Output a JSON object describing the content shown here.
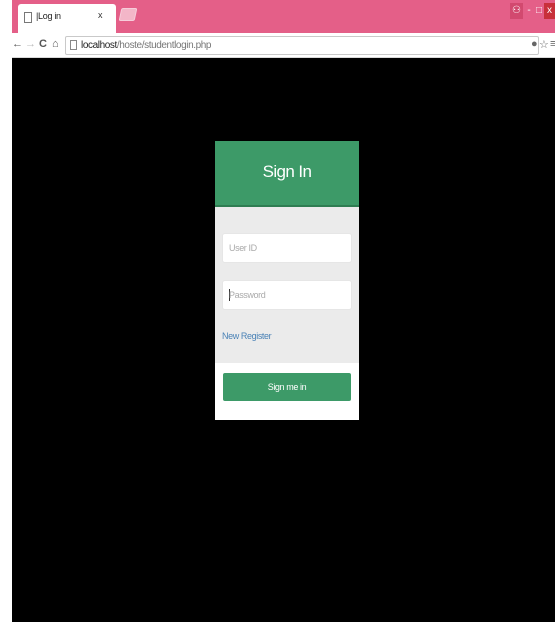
{
  "browser": {
    "tab_title": "|Log in",
    "tab_close": "x",
    "url_host": "localhost",
    "url_path": "/hoste/studentlogin.php",
    "window_controls": {
      "minimize": "-",
      "maximize": "□",
      "close": "x"
    }
  },
  "login": {
    "title": "Sign In",
    "user_placeholder": "User ID",
    "password_placeholder": "Password",
    "register_link": "New Register",
    "submit_label": "Sign me in"
  },
  "colors": {
    "accent_green": "#3d9a68",
    "titlebar_pink": "#e45f88",
    "link_blue": "#4a82b6",
    "background": "#000000"
  },
  "icons": [
    "page-icon",
    "back-icon",
    "forward-icon",
    "reload-icon",
    "home-icon",
    "extension-icon",
    "star-icon",
    "menu-icon",
    "user-icon"
  ]
}
